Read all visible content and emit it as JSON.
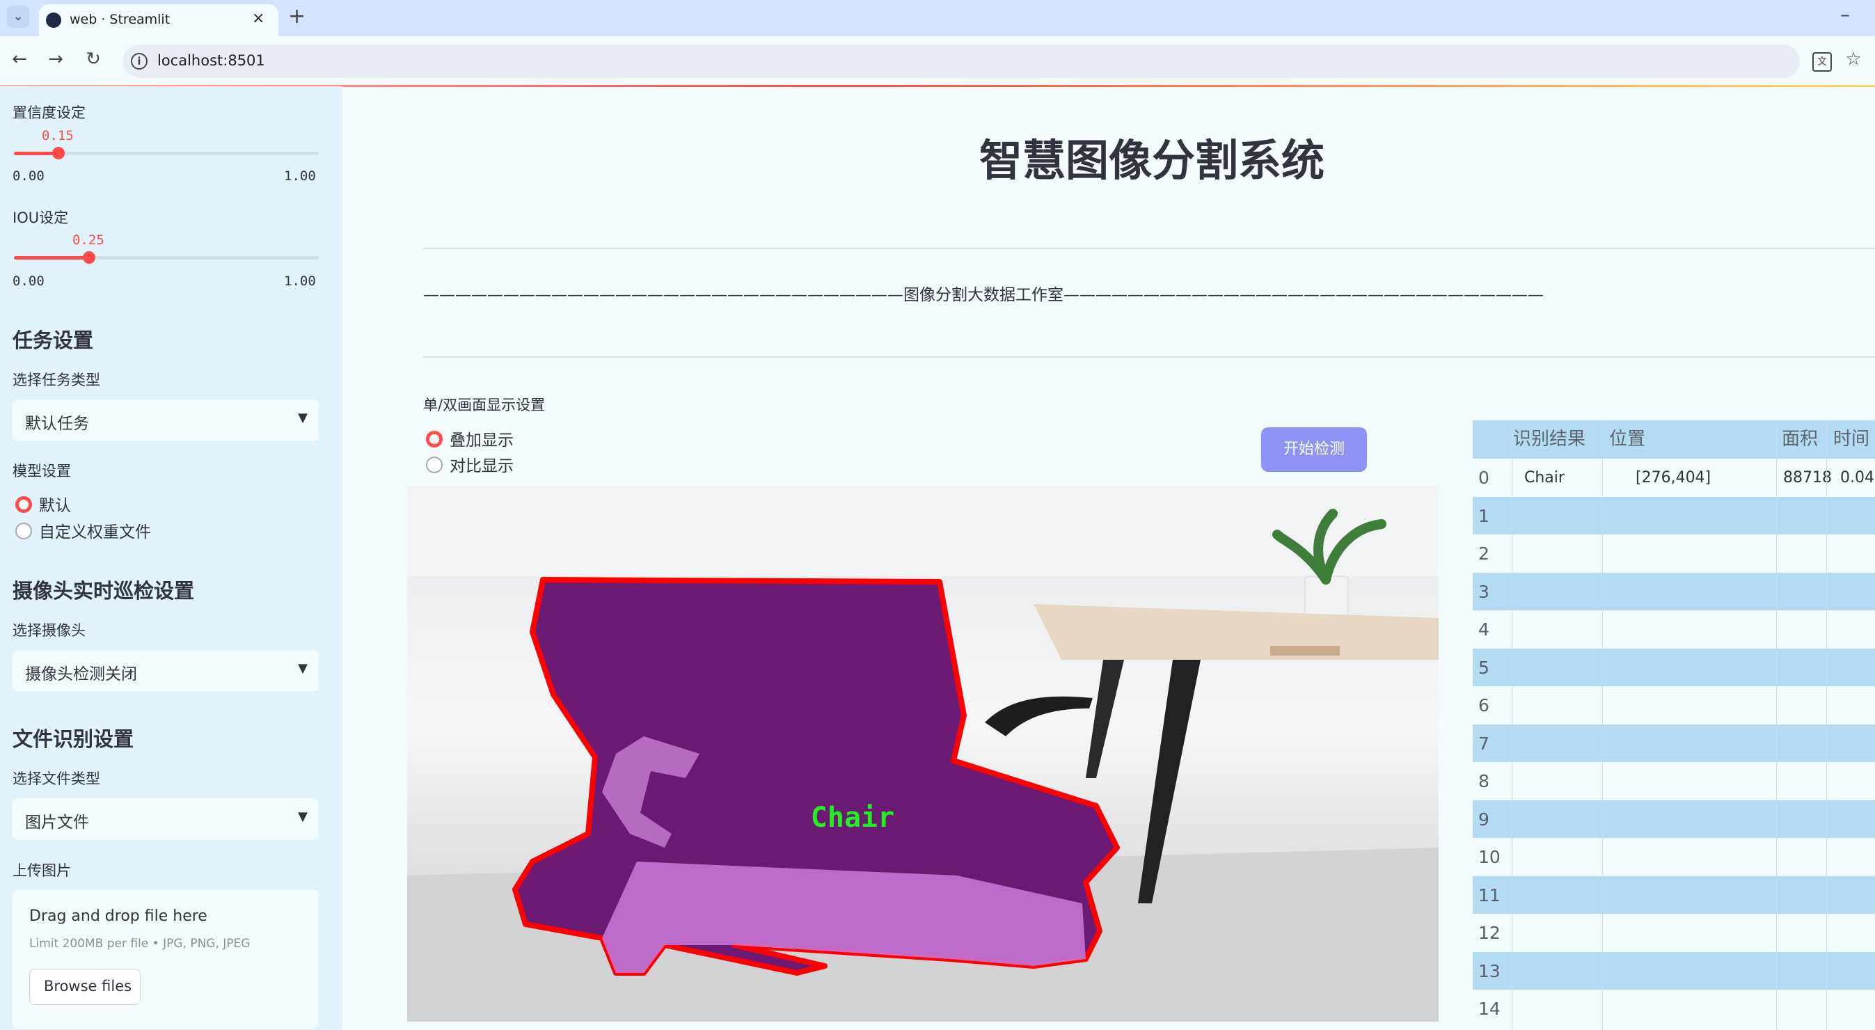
{
  "browser": {
    "tab_title": "web · Streamlit",
    "tab_close": "×",
    "new_tab": "+",
    "url": "localhost:8501",
    "minimize": "–"
  },
  "sidebar": {
    "confidence": {
      "label": "置信度设定",
      "value": "0.15",
      "min": "0.00",
      "max": "1.00",
      "fraction": 0.15
    },
    "iou": {
      "label": "IOU设定",
      "value": "0.25",
      "min": "0.00",
      "max": "1.00",
      "fraction": 0.25
    },
    "task_section": "任务设置",
    "task_type_label": "选择任务类型",
    "task_type_value": "默认任务",
    "model_label": "模型设置",
    "model_options": [
      "默认",
      "自定义权重文件"
    ],
    "camera_section": "摄像头实时巡检设置",
    "camera_label": "选择摄像头",
    "camera_value": "摄像头检测关闭",
    "file_section": "文件识别设置",
    "file_type_label": "选择文件类型",
    "file_type_value": "图片文件",
    "upload_label": "上传图片",
    "drop_text": "Drag and drop file here",
    "drop_limit": "Limit 200MB per file • JPG, PNG, JPEG",
    "browse": "Browse files"
  },
  "main": {
    "title": "智慧图像分割系统",
    "banner": "——————————————————————————————图像分割大数据工作室——————————————————————————————",
    "display_label": "单/双画面显示设置",
    "display_options": [
      "叠加显示",
      "对比显示"
    ],
    "start_button": "开始检测",
    "detection_label": "Chair"
  },
  "table": {
    "headers": [
      "识别结果",
      "位置",
      "面积",
      "时间"
    ],
    "rows": [
      {
        "index": "0",
        "result": "Chair",
        "position": "[276,404]",
        "area": "88718",
        "time": "0.04"
      },
      {
        "index": "1"
      },
      {
        "index": "2"
      },
      {
        "index": "3"
      },
      {
        "index": "4"
      },
      {
        "index": "5"
      },
      {
        "index": "6"
      },
      {
        "index": "7"
      },
      {
        "index": "8"
      },
      {
        "index": "9"
      },
      {
        "index": "10"
      },
      {
        "index": "11"
      },
      {
        "index": "12"
      },
      {
        "index": "13"
      },
      {
        "index": "14"
      }
    ]
  },
  "colors": {
    "accent": "#ff4b4b",
    "button": "#8e93f5",
    "mask_outline": "#ff0000",
    "label_green": "#22ee22"
  }
}
